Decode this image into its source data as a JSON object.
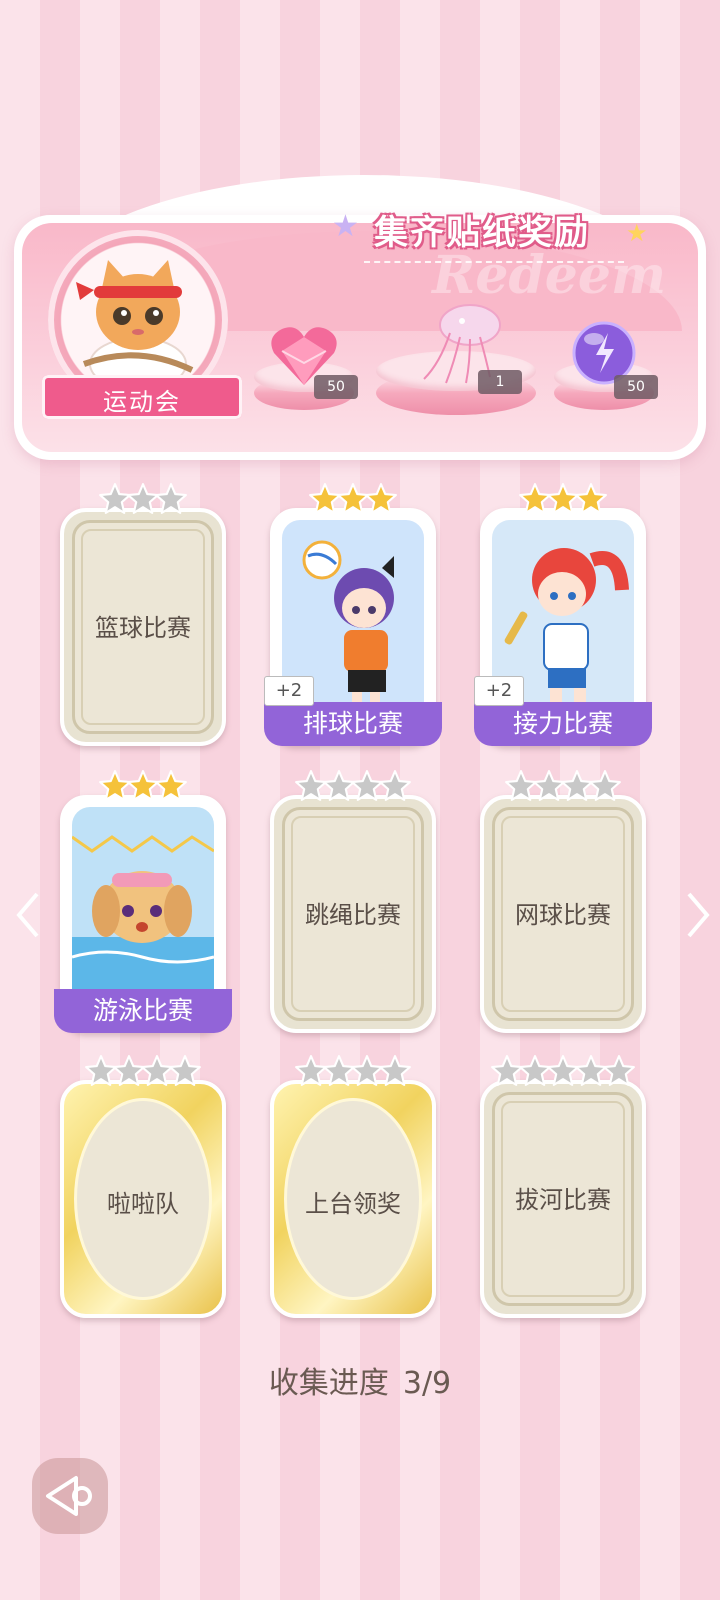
{
  "banner": {
    "title": "集齐贴纸奖励",
    "watermark": "Redeem",
    "event_label": "运动会",
    "rewards": [
      {
        "icon": "pink-heart-gem-icon",
        "count": "50"
      },
      {
        "icon": "jellyfish-decoration-icon",
        "count": "1"
      },
      {
        "icon": "purple-energy-orb-icon",
        "count": "50"
      }
    ]
  },
  "cards": [
    {
      "label": "篮球比赛",
      "state": "locked",
      "frame": "silver",
      "stars_total": 3,
      "stars_filled": 0
    },
    {
      "label": "排球比赛",
      "state": "collected",
      "frame": "photo",
      "stars_total": 3,
      "stars_filled": 3,
      "bonus": "+2"
    },
    {
      "label": "接力比赛",
      "state": "collected",
      "frame": "photo",
      "stars_total": 3,
      "stars_filled": 3,
      "bonus": "+2"
    },
    {
      "label": "游泳比赛",
      "state": "collected",
      "frame": "photo",
      "stars_total": 3,
      "stars_filled": 3
    },
    {
      "label": "跳绳比赛",
      "state": "locked",
      "frame": "silver",
      "stars_total": 4,
      "stars_filled": 0
    },
    {
      "label": "网球比赛",
      "state": "locked",
      "frame": "silver",
      "stars_total": 4,
      "stars_filled": 0
    },
    {
      "label": "啦啦队",
      "state": "locked",
      "frame": "gold",
      "stars_total": 4,
      "stars_filled": 0
    },
    {
      "label": "上台领奖",
      "state": "locked",
      "frame": "gold",
      "stars_total": 4,
      "stars_filled": 0
    },
    {
      "label": "拔河比赛",
      "state": "locked",
      "frame": "silver",
      "stars_total": 5,
      "stars_filled": 0
    }
  ],
  "progress": {
    "label": "收集进度",
    "value": "3/9"
  },
  "colors": {
    "accent": "#9264d8",
    "star_gold": "#f5c23a",
    "star_silver": "#c8c8c8",
    "banner_pink": "#f9b8c9"
  },
  "nav": {
    "prev_icon": "chevron-left-icon",
    "next_icon": "chevron-right-icon",
    "back_icon": "back-arrow-icon"
  }
}
